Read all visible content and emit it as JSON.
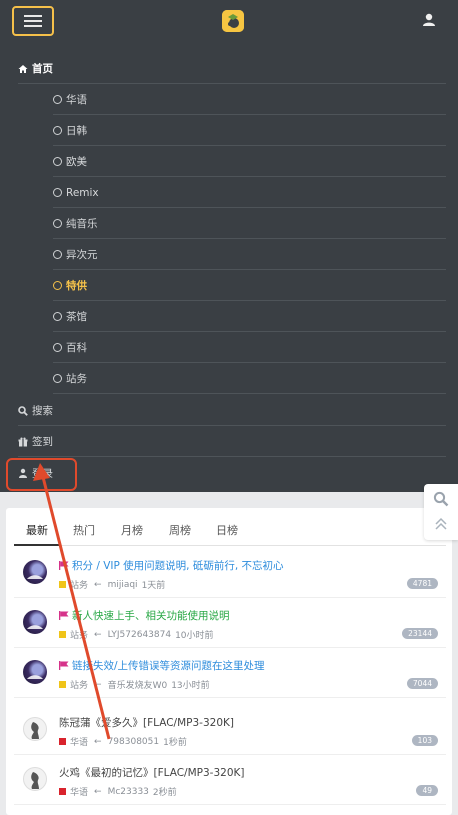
{
  "header": {
    "menu_icon": "hamburger-icon",
    "logo_icon": "site-logo-icon",
    "user_icon": "user-icon"
  },
  "menu": {
    "home": "首页",
    "sub_items": [
      "华语",
      "日韩",
      "欧美",
      "Remix",
      "纯音乐",
      "异次元",
      "特供",
      "茶馆",
      "百科",
      "站务"
    ],
    "active_sub": "特供",
    "search": "搜索",
    "checkin": "签到",
    "login": "登录"
  },
  "tabs": [
    "最新",
    "热门",
    "月榜",
    "周榜",
    "日榜"
  ],
  "active_tab": "最新",
  "threads": [
    {
      "title": "积分 / VIP 使用问题说明, 砥砺前行, 不忘初心",
      "title_color": "#2f8ddc",
      "pinned": true,
      "category": "站务",
      "category_color": "#f0c419",
      "arrow": "←",
      "user": "mijiaqi",
      "time": "1天前",
      "count": "4781",
      "avatar": "dark"
    },
    {
      "title": "新人快速上手、相关功能使用说明",
      "title_color": "#28a745",
      "pinned": true,
      "category": "站务",
      "category_color": "#f0c419",
      "arrow": "←",
      "user": "LYJ572643874",
      "time": "10小时前",
      "count": "23144",
      "avatar": "dark"
    },
    {
      "title": "链接失效/上传错误等资源问题在这里处理",
      "title_color": "#2f8ddc",
      "pinned": true,
      "category": "站务",
      "category_color": "#f0c419",
      "arrow": "←",
      "user": "音乐发烧友W0",
      "time": "13小时前",
      "count": "7044",
      "avatar": "dark"
    },
    {
      "title": "陈冠蒲《爱多久》[FLAC/MP3-320K]",
      "title_color": "#444444",
      "pinned": false,
      "category": "华语",
      "category_color": "#d9232d",
      "arrow": "←",
      "user": "798308051",
      "time": "1秒前",
      "count": "103",
      "avatar": "light"
    },
    {
      "title": "火鸡《最初的记忆》[FLAC/MP3-320K]",
      "title_color": "#444444",
      "pinned": false,
      "category": "华语",
      "category_color": "#d9232d",
      "arrow": "←",
      "user": "Mc23333",
      "time": "2秒前",
      "count": "49",
      "avatar": "light"
    }
  ],
  "float_tools": {
    "search_icon": "search-icon",
    "top_icon": "back-to-top-icon"
  },
  "colors": {
    "nav_bg": "#3a3f44",
    "accent": "#f5c24a",
    "highlight_red": "#e04a2c",
    "pin_flag": "#d6338a"
  }
}
